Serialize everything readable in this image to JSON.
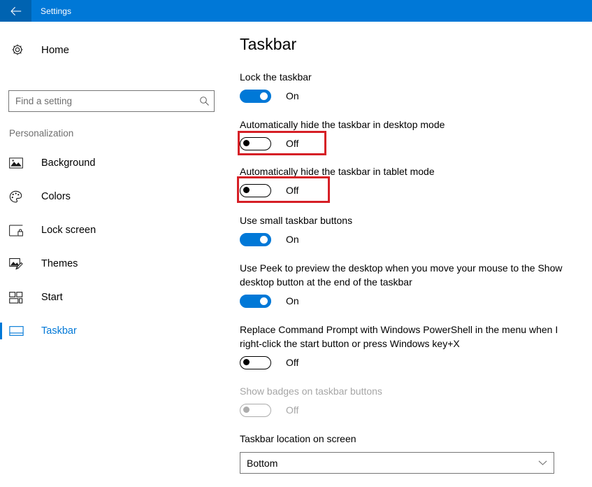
{
  "titlebar": {
    "back_icon": "back-arrow-icon",
    "title": "Settings",
    "accent_color": "#0078d7",
    "back_bg_color": "#0063b1"
  },
  "sidebar": {
    "home": {
      "label": "Home",
      "icon": "gear-icon"
    },
    "search": {
      "value": "",
      "placeholder": "Find a setting",
      "icon": "search-icon"
    },
    "group_label": "Personalization",
    "items": [
      {
        "label": "Background",
        "icon": "image-icon",
        "selected": false
      },
      {
        "label": "Colors",
        "icon": "palette-icon",
        "selected": false
      },
      {
        "label": "Lock screen",
        "icon": "lock-screen-icon",
        "selected": false
      },
      {
        "label": "Themes",
        "icon": "brush-icon",
        "selected": false
      },
      {
        "label": "Start",
        "icon": "start-tiles-icon",
        "selected": false
      },
      {
        "label": "Taskbar",
        "icon": "taskbar-icon",
        "selected": true
      }
    ],
    "selected_color": "#0078d7"
  },
  "main": {
    "title": "Taskbar",
    "settings": [
      {
        "label": "Lock the taskbar",
        "state": "On",
        "on": true,
        "disabled": false,
        "highlighted": false
      },
      {
        "label": "Automatically hide the taskbar in desktop mode",
        "state": "Off",
        "on": false,
        "disabled": false,
        "highlighted": true
      },
      {
        "label": "Automatically hide the taskbar in tablet mode",
        "state": "Off",
        "on": false,
        "disabled": false,
        "highlighted": true
      },
      {
        "label": "Use small taskbar buttons",
        "state": "On",
        "on": true,
        "disabled": false,
        "highlighted": false
      },
      {
        "label": "Use Peek to preview the desktop when you move your mouse to the Show desktop button at the end of the taskbar",
        "state": "On",
        "on": true,
        "disabled": false,
        "highlighted": false
      },
      {
        "label": "Replace Command Prompt with Windows PowerShell in the menu when I right-click the start button or press Windows key+X",
        "state": "Off",
        "on": false,
        "disabled": false,
        "highlighted": false
      },
      {
        "label": "Show badges on taskbar buttons",
        "state": "Off",
        "on": false,
        "disabled": true,
        "highlighted": false
      }
    ],
    "dropdown_setting": {
      "label": "Taskbar location on screen",
      "value": "Bottom",
      "chevron_icon": "chevron-down-icon"
    },
    "highlight_color": "#d61f26"
  }
}
